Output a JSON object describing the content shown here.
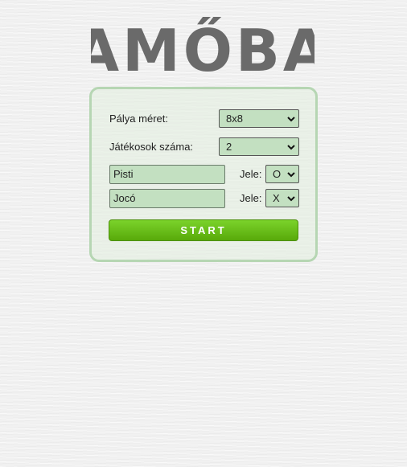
{
  "logo": {
    "text": "AMŐBA"
  },
  "form": {
    "board_size_label": "Pálya méret:",
    "board_size_value": "8x8",
    "players_label": "Játékosok száma:",
    "players_value": "2",
    "players": [
      {
        "name": "Pisti",
        "mark_label": "Jele:",
        "mark": "O"
      },
      {
        "name": "Jocó",
        "mark_label": "Jele:",
        "mark": "X"
      }
    ],
    "start_label": "START"
  },
  "colors": {
    "accent": "#66bb11",
    "panel_border": "#b6d6b3",
    "field_bg": "#c3e0c1",
    "logo": "#6a6a6a"
  },
  "icons": {
    "dropdown": "chevron-down-icon"
  }
}
